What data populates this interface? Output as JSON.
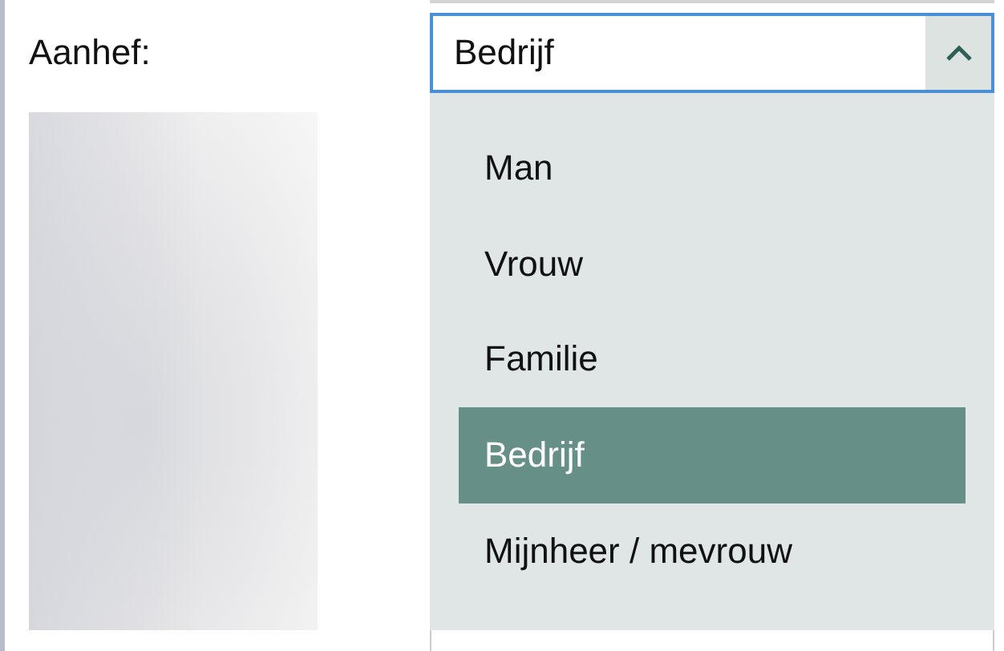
{
  "field": {
    "label": "Aanhef:",
    "value": "Bedrijf",
    "expanded": true
  },
  "options": [
    {
      "label": "Man",
      "selected": false
    },
    {
      "label": "Vrouw",
      "selected": false
    },
    {
      "label": "Familie",
      "selected": false
    },
    {
      "label": "Bedrijf",
      "selected": true
    },
    {
      "label": "Mijnheer / mevrouw",
      "selected": false
    }
  ]
}
